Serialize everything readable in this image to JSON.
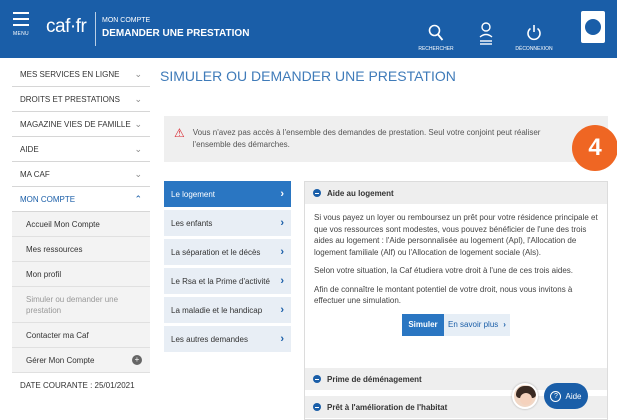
{
  "header": {
    "menu_label": "MENU",
    "logo": "caf·fr",
    "supertitle": "MON COMPTE",
    "title": "DEMANDER UNE PRESTATION",
    "search_label": "RECHERCHER",
    "logout_label": "DÉCONNEXION"
  },
  "sidebar": {
    "items": [
      {
        "label": "MES SERVICES EN LIGNE"
      },
      {
        "label": "DROITS ET PRESTATIONS"
      },
      {
        "label": "MAGAZINE VIES DE FAMILLE"
      },
      {
        "label": "AIDE"
      },
      {
        "label": "MA CAF"
      },
      {
        "label": "MON COMPTE"
      }
    ],
    "subitems": [
      {
        "label": "Accueil Mon Compte"
      },
      {
        "label": "Mes ressources"
      },
      {
        "label": "Mon profil"
      },
      {
        "label": "Simuler ou demander une prestation"
      },
      {
        "label": "Contacter ma Caf"
      },
      {
        "label": "Gérer Mon Compte"
      }
    ],
    "date": "DATE COURANTE : 25/01/2021"
  },
  "main": {
    "title": "SIMULER OU DEMANDER UNE PRESTATION",
    "alert": "Vous n'avez pas accès à l'ensemble des demandes de prestation. Seul votre conjoint peut réaliser l'ensemble des démarches.",
    "step": "4",
    "tabs": [
      {
        "label": "Le logement"
      },
      {
        "label": "Les enfants"
      },
      {
        "label": "La séparation et le décès"
      },
      {
        "label": "Le Rsa et la Prime d'activité"
      },
      {
        "label": "La maladie et le handicap"
      },
      {
        "label": "Les autres demandes"
      }
    ],
    "panel": {
      "heading": "Aide au logement",
      "para1": "Si vous payez un loyer ou remboursez un prêt pour votre résidence principale et que vos ressources sont modestes, vous pouvez bénéficier de l'une des trois aides au logement : l'Aide personnalisée au logement (Apl), l'Allocation de logement familiale (Alf) ou l'Allocation de logement sociale (Als).",
      "para2": "Selon votre situation, la Caf étudiera votre droit à l'une de ces trois aides.",
      "para3": "Afin de connaître le montant potentiel de votre droit, nous vous invitons à effectuer une simulation.",
      "simulate_label": "Simuler",
      "more_label": "En savoir plus",
      "acc1": "Prime de déménagement",
      "acc2": "Prêt à l'amélioration de l'habitat"
    },
    "help_label": "Aide"
  },
  "colors": {
    "brand_blue": "#1a5ea8",
    "tab_active": "#2a76c2",
    "step_orange": "#ef6623",
    "alert_red": "#d9232d"
  }
}
